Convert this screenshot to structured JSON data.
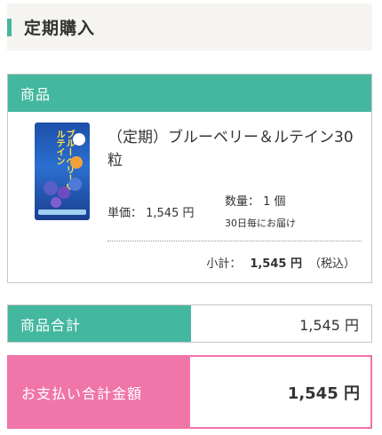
{
  "header": {
    "title": "定期購入"
  },
  "product_section": {
    "heading": "商品",
    "item": {
      "name": "（定期）ブルーベリー＆ルテイン30粒",
      "image_label": "ブルーベリー&ルテインつぶタイプ",
      "unit_price_label": "単価： 1,545 円",
      "quantity_label": "数量： 1 個",
      "delivery_note": "30日毎にお届け",
      "subtotal_label": "小計：",
      "subtotal_amount": "1,545 円",
      "tax_note": "（税込）"
    }
  },
  "summary": {
    "items_total_label": "商品合計",
    "items_total_value": "1,545 円",
    "payment_total_label": "お支払い合計金額",
    "payment_total_value": "1,545 円"
  },
  "colors": {
    "accent_green": "#44b89e",
    "accent_pink": "#f075a8",
    "header_bg": "#f5f4f0"
  }
}
